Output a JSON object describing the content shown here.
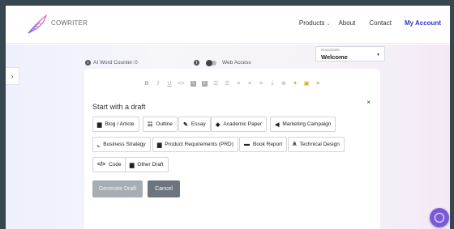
{
  "header": {
    "brand": "COWRITER",
    "nav": {
      "products": "Products",
      "about": "About",
      "contact": "Contact",
      "account": "My Account"
    },
    "accent": "#2b35c9"
  },
  "controls": {
    "side_toggle": "›",
    "word_counter_label": "AI Word Counter:",
    "word_counter_value": "0",
    "web_access_label": "Web Access",
    "web_access_on": false,
    "documents_label": "Documents",
    "documents_value": "Welcome"
  },
  "toolbar": {
    "icons": [
      "bold-icon",
      "italic-icon",
      "underline-icon",
      "code-icon",
      "heading1-icon",
      "heading2-icon",
      "bullet-list-icon",
      "numbered-list-icon",
      "align-left-icon",
      "align-center-icon",
      "align-right-icon",
      "download-icon",
      "add-doc-icon",
      "magic-wand-icon",
      "image-icon",
      "list-settings-icon"
    ]
  },
  "panel": {
    "title": "Start with a draft",
    "close": "×",
    "options": [
      {
        "label": "Blog / Article",
        "icon": "document-icon"
      },
      {
        "label": "Outline",
        "icon": "list-icon"
      },
      {
        "label": "Essay",
        "icon": "edit-icon"
      },
      {
        "label": "Academic Paper",
        "icon": "graduation-icon"
      },
      {
        "label": "Marketing Campaign",
        "icon": "megaphone-icon"
      },
      {
        "label": "Business Strategy",
        "icon": "chart-icon"
      },
      {
        "label": "Product Requirements (PRD)",
        "icon": "clipboard-icon"
      },
      {
        "label": "Book Report",
        "icon": "book-icon"
      },
      {
        "label": "Technical Design",
        "icon": "drafting-icon"
      },
      {
        "label": "Code",
        "icon": "code-icon"
      },
      {
        "label": "Other Draft",
        "icon": "document-icon"
      }
    ],
    "generate_label": "Generate Draft",
    "cancel_label": "Cancel"
  }
}
